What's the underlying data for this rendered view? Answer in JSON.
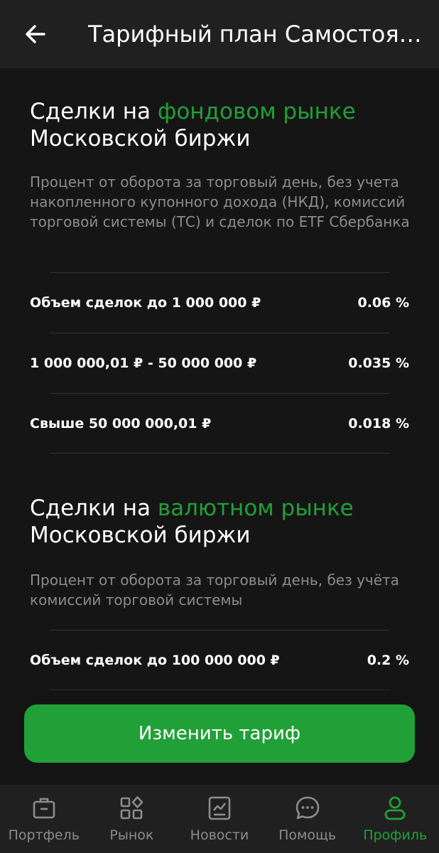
{
  "header": {
    "title": "Тарифный план Самостоят...",
    "back_icon": "arrow-left-icon"
  },
  "stock_section": {
    "title_prefix": "Сделки на ",
    "title_accent": "фондовом рынке",
    "title_line2": "Московской биржи",
    "description": "Процент от оборота за торговый день, без учета накопленного купонного дохода (НКД), комиссий торговой системы (ТС) и сделок по ETF Сбербанка",
    "rows": [
      {
        "label": "Объем сделок до 1 000 000 ₽",
        "value": "0.06 %"
      },
      {
        "label": "1 000 000,01 ₽ - 50 000 000 ₽",
        "value": "0.035 %"
      },
      {
        "label": "Свыше 50 000 000,01 ₽",
        "value": "0.018 %"
      }
    ]
  },
  "fx_section": {
    "title_prefix": "Сделки на ",
    "title_accent": "валютном рынке",
    "title_line2": "Московской биржи",
    "description": "Процент от оборота за торговый день, без учёта комиссий торговой системы",
    "rows": [
      {
        "label": "Объем сделок до 100 000 000 ₽",
        "value": "0.2 %"
      }
    ]
  },
  "cta": {
    "label": "Изменить тариф"
  },
  "nav": {
    "items": [
      {
        "label": "Портфель",
        "icon": "briefcase-icon"
      },
      {
        "label": "Рынок",
        "icon": "market-grid-icon"
      },
      {
        "label": "Новости",
        "icon": "news-chart-icon"
      },
      {
        "label": "Помощь",
        "icon": "chat-bubble-icon"
      },
      {
        "label": "Профиль",
        "icon": "profile-icon"
      }
    ],
    "active": "Профиль"
  },
  "colors": {
    "accent": "#21a038",
    "background": "#151515",
    "bar": "#202020",
    "muted": "#8c8c8c"
  }
}
